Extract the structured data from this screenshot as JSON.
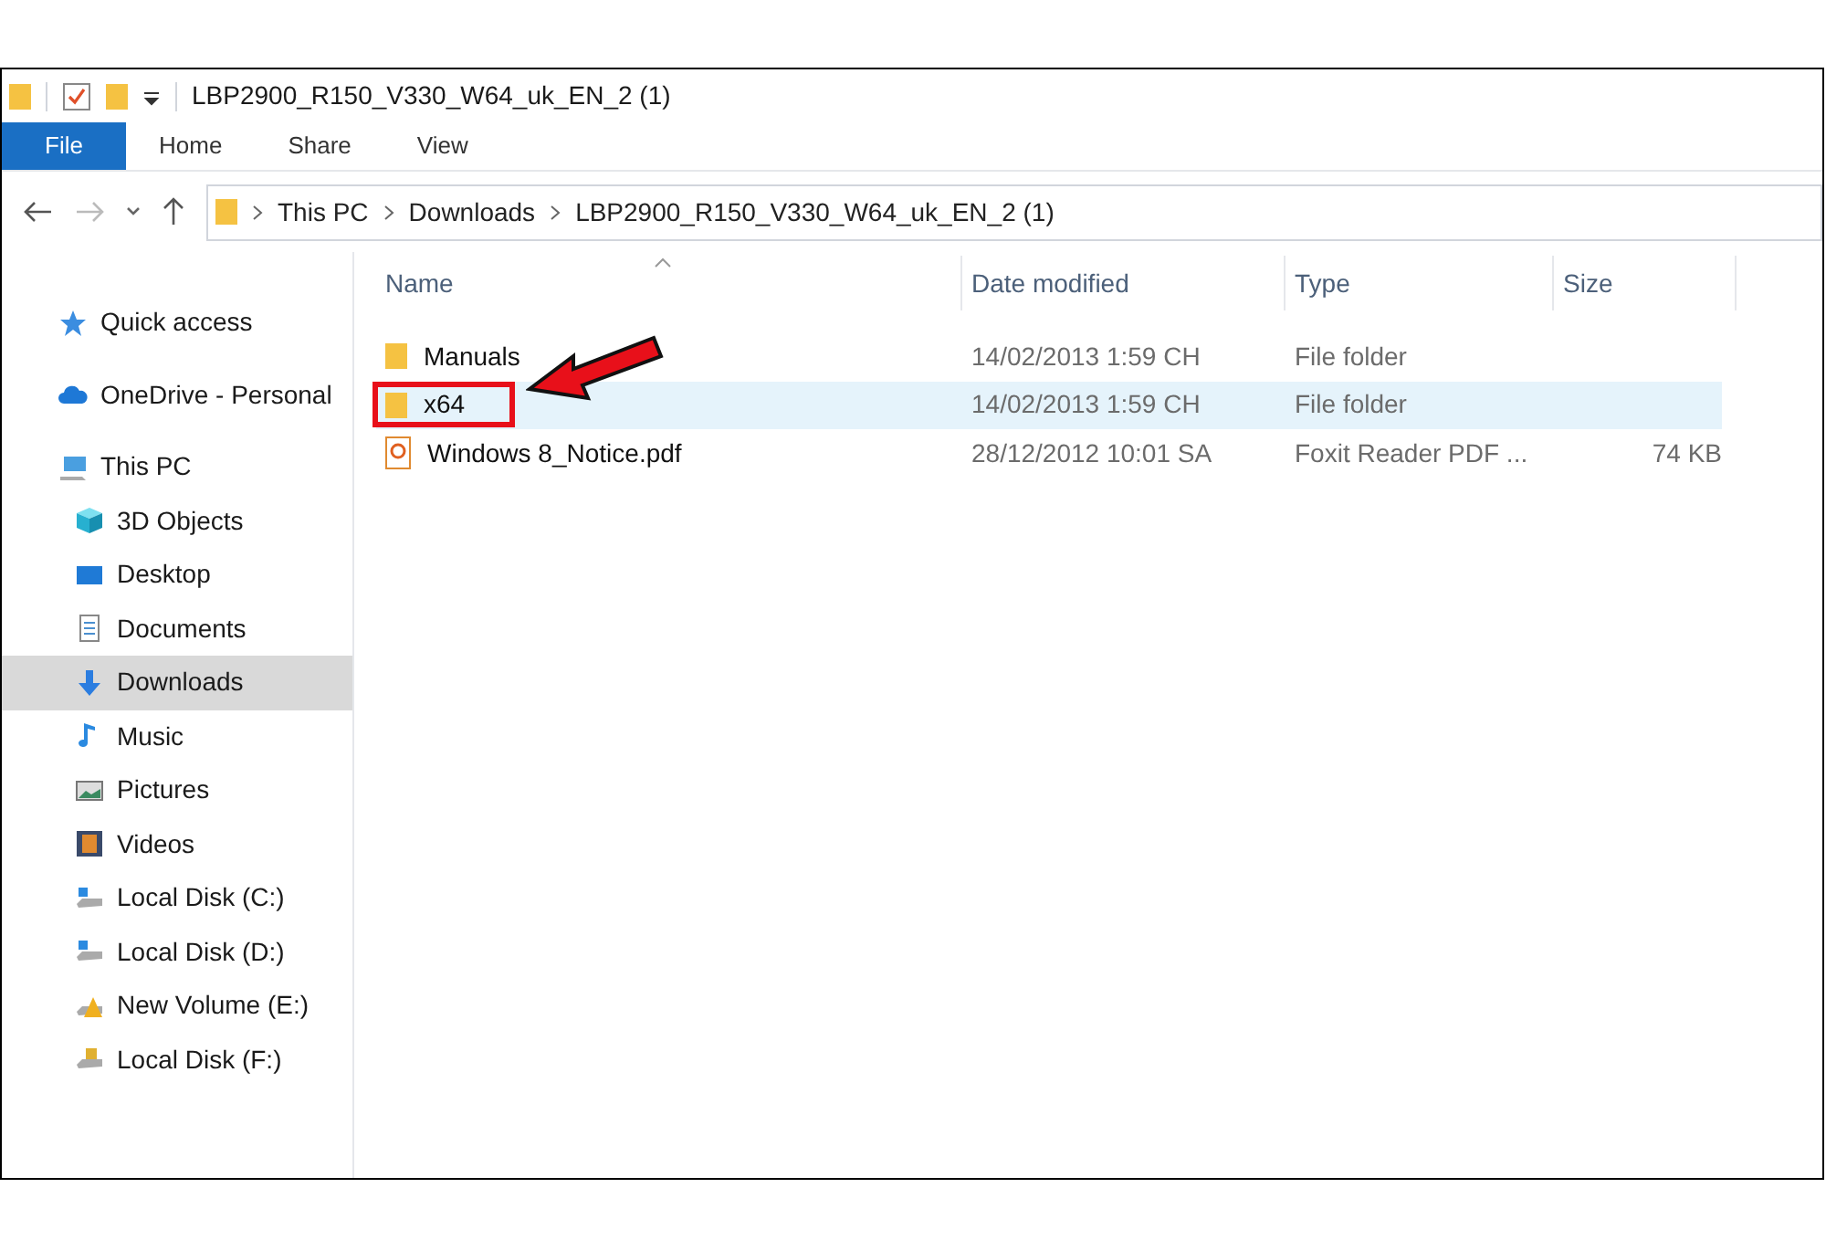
{
  "window": {
    "title": "LBP2900_R150_V330_W64_uk_EN_2 (1)"
  },
  "ribbon_tabs": [
    {
      "label": "File",
      "selected": true
    },
    {
      "label": "Home",
      "selected": false
    },
    {
      "label": "Share",
      "selected": false
    },
    {
      "label": "View",
      "selected": false
    }
  ],
  "breadcrumb": [
    "This PC",
    "Downloads",
    "LBP2900_R150_V330_W64_uk_EN_2 (1)"
  ],
  "sidebar": {
    "items": [
      {
        "label": "Quick access",
        "kind": "star",
        "selected": false
      },
      {
        "label": "OneDrive - Personal",
        "kind": "cloud",
        "selected": false
      },
      {
        "label": "This PC",
        "kind": "pc",
        "selected": false,
        "children": [
          {
            "label": "3D Objects",
            "kind": "cube",
            "selected": false
          },
          {
            "label": "Desktop",
            "kind": "desktop",
            "selected": false
          },
          {
            "label": "Documents",
            "kind": "document",
            "selected": false
          },
          {
            "label": "Downloads",
            "kind": "download",
            "selected": true
          },
          {
            "label": "Music",
            "kind": "music",
            "selected": false
          },
          {
            "label": "Pictures",
            "kind": "picture",
            "selected": false
          },
          {
            "label": "Videos",
            "kind": "video",
            "selected": false
          },
          {
            "label": "Local Disk (C:)",
            "kind": "drive",
            "selected": false
          },
          {
            "label": "Local Disk (D:)",
            "kind": "drive",
            "selected": false
          },
          {
            "label": "New Volume (E:)",
            "kind": "warn-drive",
            "selected": false
          },
          {
            "label": "Local Disk (F:)",
            "kind": "lock-drive",
            "selected": false
          }
        ]
      }
    ]
  },
  "table": {
    "columns": [
      "Name",
      "Date modified",
      "Type",
      "Size"
    ],
    "rows": [
      {
        "kind": "folder",
        "name": "Manuals",
        "date": "14/02/2013 1:59 CH",
        "type": "File folder",
        "size": "",
        "selected": false,
        "highlighted": false
      },
      {
        "kind": "folder",
        "name": "x64",
        "date": "14/02/2013 1:59 CH",
        "type": "File folder",
        "size": "",
        "selected": true,
        "highlighted": true
      },
      {
        "kind": "pdf",
        "name": "Windows 8_Notice.pdf",
        "date": "28/12/2012 10:01 SA",
        "type": "Foxit Reader PDF ...",
        "size": "74 KB",
        "selected": false,
        "highlighted": false
      }
    ]
  }
}
